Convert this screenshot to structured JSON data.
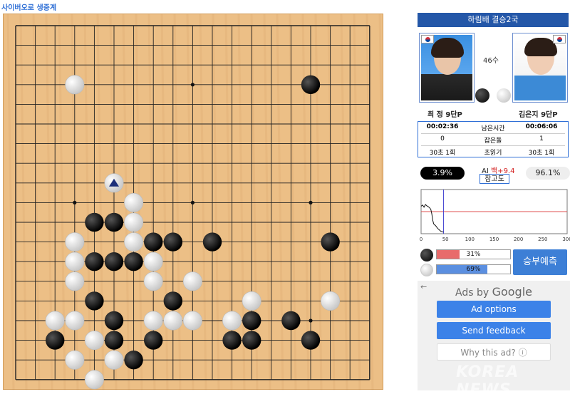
{
  "header": {
    "title": "사이버오로 생중계"
  },
  "match": {
    "title": "하림배 결승2국",
    "move_count": "46수"
  },
  "players": {
    "black": {
      "name": "최 정  9단P",
      "flag": "korea-flag",
      "stone": "black"
    },
    "white": {
      "name": "김은지  9단P",
      "flag": "korea-flag",
      "stone": "white"
    }
  },
  "info": {
    "rows": [
      {
        "black": "00:02:36",
        "label": "남은시간",
        "white": "00:06:06"
      },
      {
        "black": "0",
        "label": "잡은돌",
        "white": "1"
      },
      {
        "black": "30초 1회",
        "label": "초읽기",
        "white": "30초 1회"
      }
    ]
  },
  "ai": {
    "black_pct": "3.9%",
    "white_pct": "96.1%",
    "label": "AI",
    "eval": "백+9.4",
    "ref_button": "참고도"
  },
  "graph": {
    "x_ticks": [
      "0",
      "50",
      "100",
      "150",
      "200",
      "250",
      "300"
    ],
    "current_move": 46,
    "x_max": 300,
    "win_series": [
      [
        0,
        0.62
      ],
      [
        3,
        0.65
      ],
      [
        6,
        0.6
      ],
      [
        9,
        0.66
      ],
      [
        12,
        0.63
      ],
      [
        15,
        0.61
      ],
      [
        18,
        0.58
      ],
      [
        20,
        0.55
      ],
      [
        22,
        0.45
      ],
      [
        24,
        0.3
      ],
      [
        26,
        0.22
      ],
      [
        28,
        0.2
      ],
      [
        30,
        0.18
      ],
      [
        32,
        0.15
      ],
      [
        34,
        0.12
      ],
      [
        36,
        0.1
      ],
      [
        38,
        0.08
      ],
      [
        40,
        0.06
      ],
      [
        42,
        0.05
      ],
      [
        44,
        0.04
      ],
      [
        46,
        0.039
      ]
    ]
  },
  "prediction": {
    "black_pct": 31,
    "black_text": "31%",
    "white_pct": 69,
    "white_text": "69%",
    "button": "승부예측"
  },
  "ads": {
    "back": "←",
    "ads_by": "Ads by",
    "google": "Google",
    "options": "Ad options",
    "feedback": "Send feedback",
    "why": "Why this ad? ⓘ"
  },
  "watermark": "KOREA NEWS",
  "colors": {
    "board": "#ecbf86",
    "header_blue": "#2457a8",
    "accent_blue": "#2f6fd6",
    "black_bar": "#e86b6b",
    "white_bar": "#5b8fe0",
    "graph_line": "#e05050",
    "graph_marker": "#4040d0"
  },
  "board": {
    "size": 19,
    "hoshi": [
      [
        3,
        3
      ],
      [
        9,
        3
      ],
      [
        15,
        3
      ],
      [
        3,
        9
      ],
      [
        9,
        9
      ],
      [
        15,
        9
      ],
      [
        3,
        15
      ],
      [
        9,
        15
      ],
      [
        15,
        15
      ]
    ],
    "last_move": [
      5,
      8
    ],
    "black": [
      [
        15,
        3
      ],
      [
        4,
        10
      ],
      [
        5,
        10
      ],
      [
        7,
        11
      ],
      [
        8,
        11
      ],
      [
        10,
        11
      ],
      [
        16,
        11
      ],
      [
        4,
        12
      ],
      [
        5,
        12
      ],
      [
        6,
        12
      ],
      [
        4,
        14
      ],
      [
        8,
        14
      ],
      [
        5,
        15
      ],
      [
        12,
        15
      ],
      [
        14,
        15
      ],
      [
        2,
        16
      ],
      [
        5,
        16
      ],
      [
        7,
        16
      ],
      [
        11,
        16
      ],
      [
        12,
        16
      ],
      [
        15,
        16
      ],
      [
        6,
        17
      ]
    ],
    "white": [
      [
        3,
        3
      ],
      [
        5,
        8
      ],
      [
        6,
        9
      ],
      [
        6,
        10
      ],
      [
        3,
        11
      ],
      [
        6,
        11
      ],
      [
        3,
        12
      ],
      [
        7,
        12
      ],
      [
        3,
        13
      ],
      [
        7,
        13
      ],
      [
        9,
        13
      ],
      [
        12,
        14
      ],
      [
        16,
        14
      ],
      [
        2,
        15
      ],
      [
        3,
        15
      ],
      [
        7,
        15
      ],
      [
        8,
        15
      ],
      [
        9,
        15
      ],
      [
        11,
        15
      ],
      [
        4,
        16
      ],
      [
        3,
        17
      ],
      [
        5,
        17
      ],
      [
        4,
        18
      ]
    ]
  }
}
